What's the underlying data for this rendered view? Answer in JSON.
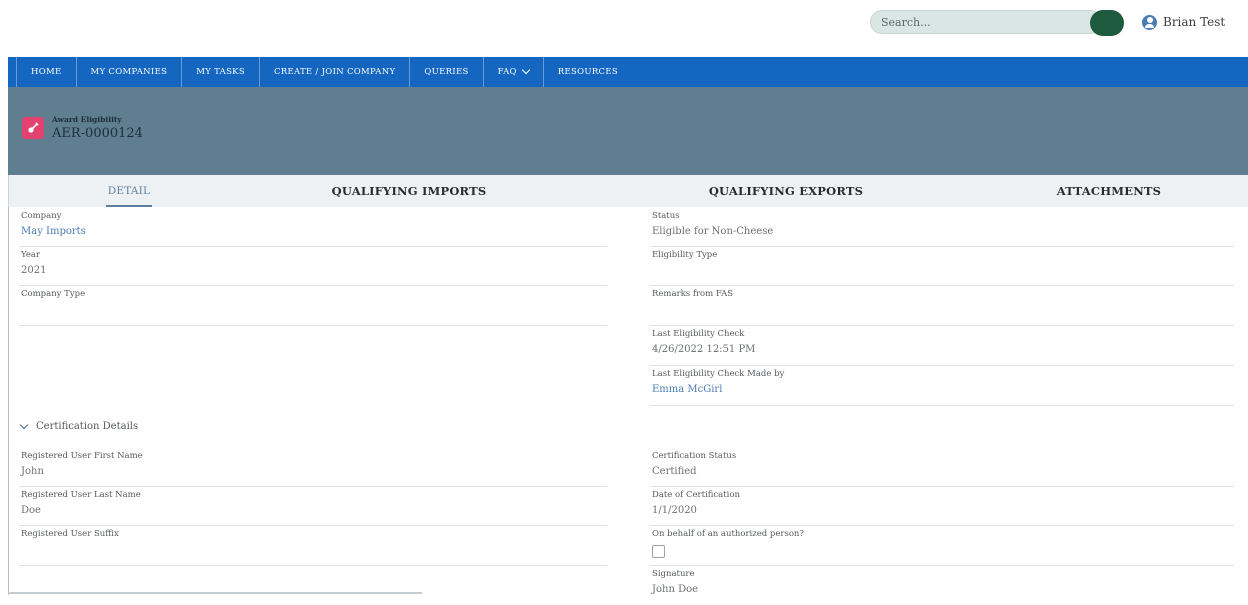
{
  "header": {
    "search_placeholder": "Search...",
    "user_name": "Brian Test"
  },
  "nav": {
    "items": [
      {
        "label": "HOME"
      },
      {
        "label": "MY COMPANIES"
      },
      {
        "label": "MY TASKS"
      },
      {
        "label": "CREATE / JOIN COMPANY"
      },
      {
        "label": "QUERIES"
      },
      {
        "label": "FAQ"
      },
      {
        "label": "RESOURCES"
      }
    ]
  },
  "record": {
    "type_label": "Award Eligibility",
    "name": "AER-0000124",
    "icon": "award-icon"
  },
  "tabs": [
    {
      "label": "DETAIL",
      "active": true
    },
    {
      "label": "QUALIFYING IMPORTS",
      "active": false
    },
    {
      "label": "QUALIFYING EXPORTS",
      "active": false
    },
    {
      "label": "ATTACHMENTS",
      "active": false
    }
  ],
  "left_fields": [
    {
      "label": "Company",
      "value": "May Imports",
      "link": true
    },
    {
      "label": "Year",
      "value": "2021"
    },
    {
      "label": "Company Type",
      "value": ""
    }
  ],
  "right_fields": [
    {
      "label": "Status",
      "value": "Eligible for Non-Cheese"
    },
    {
      "label": "Eligibility Type",
      "value": ""
    },
    {
      "label": "Remarks from FAS",
      "value": ""
    },
    {
      "label": "Last Eligibility Check",
      "value": "4/26/2022 12:51 PM"
    },
    {
      "label": "Last Eligibility Check Made by",
      "value": "Emma McGirl",
      "link": true
    }
  ],
  "certification": {
    "section_label": "Certification Details",
    "left_fields": [
      {
        "label": "Registered User First Name",
        "value": "John"
      },
      {
        "label": "Registered User Last Name",
        "value": "Doe"
      },
      {
        "label": "Registered User Suffix",
        "value": ""
      }
    ],
    "right_fields": [
      {
        "label": "Certification Status",
        "value": "Certified"
      },
      {
        "label": "Date of Certification",
        "value": "1/1/2020"
      },
      {
        "label": "On behalf of an authorized person?",
        "value": ""
      },
      {
        "label": "Signature",
        "value": "John Doe"
      }
    ],
    "on_behalf_checked": false
  },
  "colors": {
    "nav_bg": "#1466c0",
    "banner_bg": "#5f7e90",
    "search_button": "#1d5a3e",
    "link": "#4a7bb3",
    "record_icon_bg": "#e2426f"
  }
}
